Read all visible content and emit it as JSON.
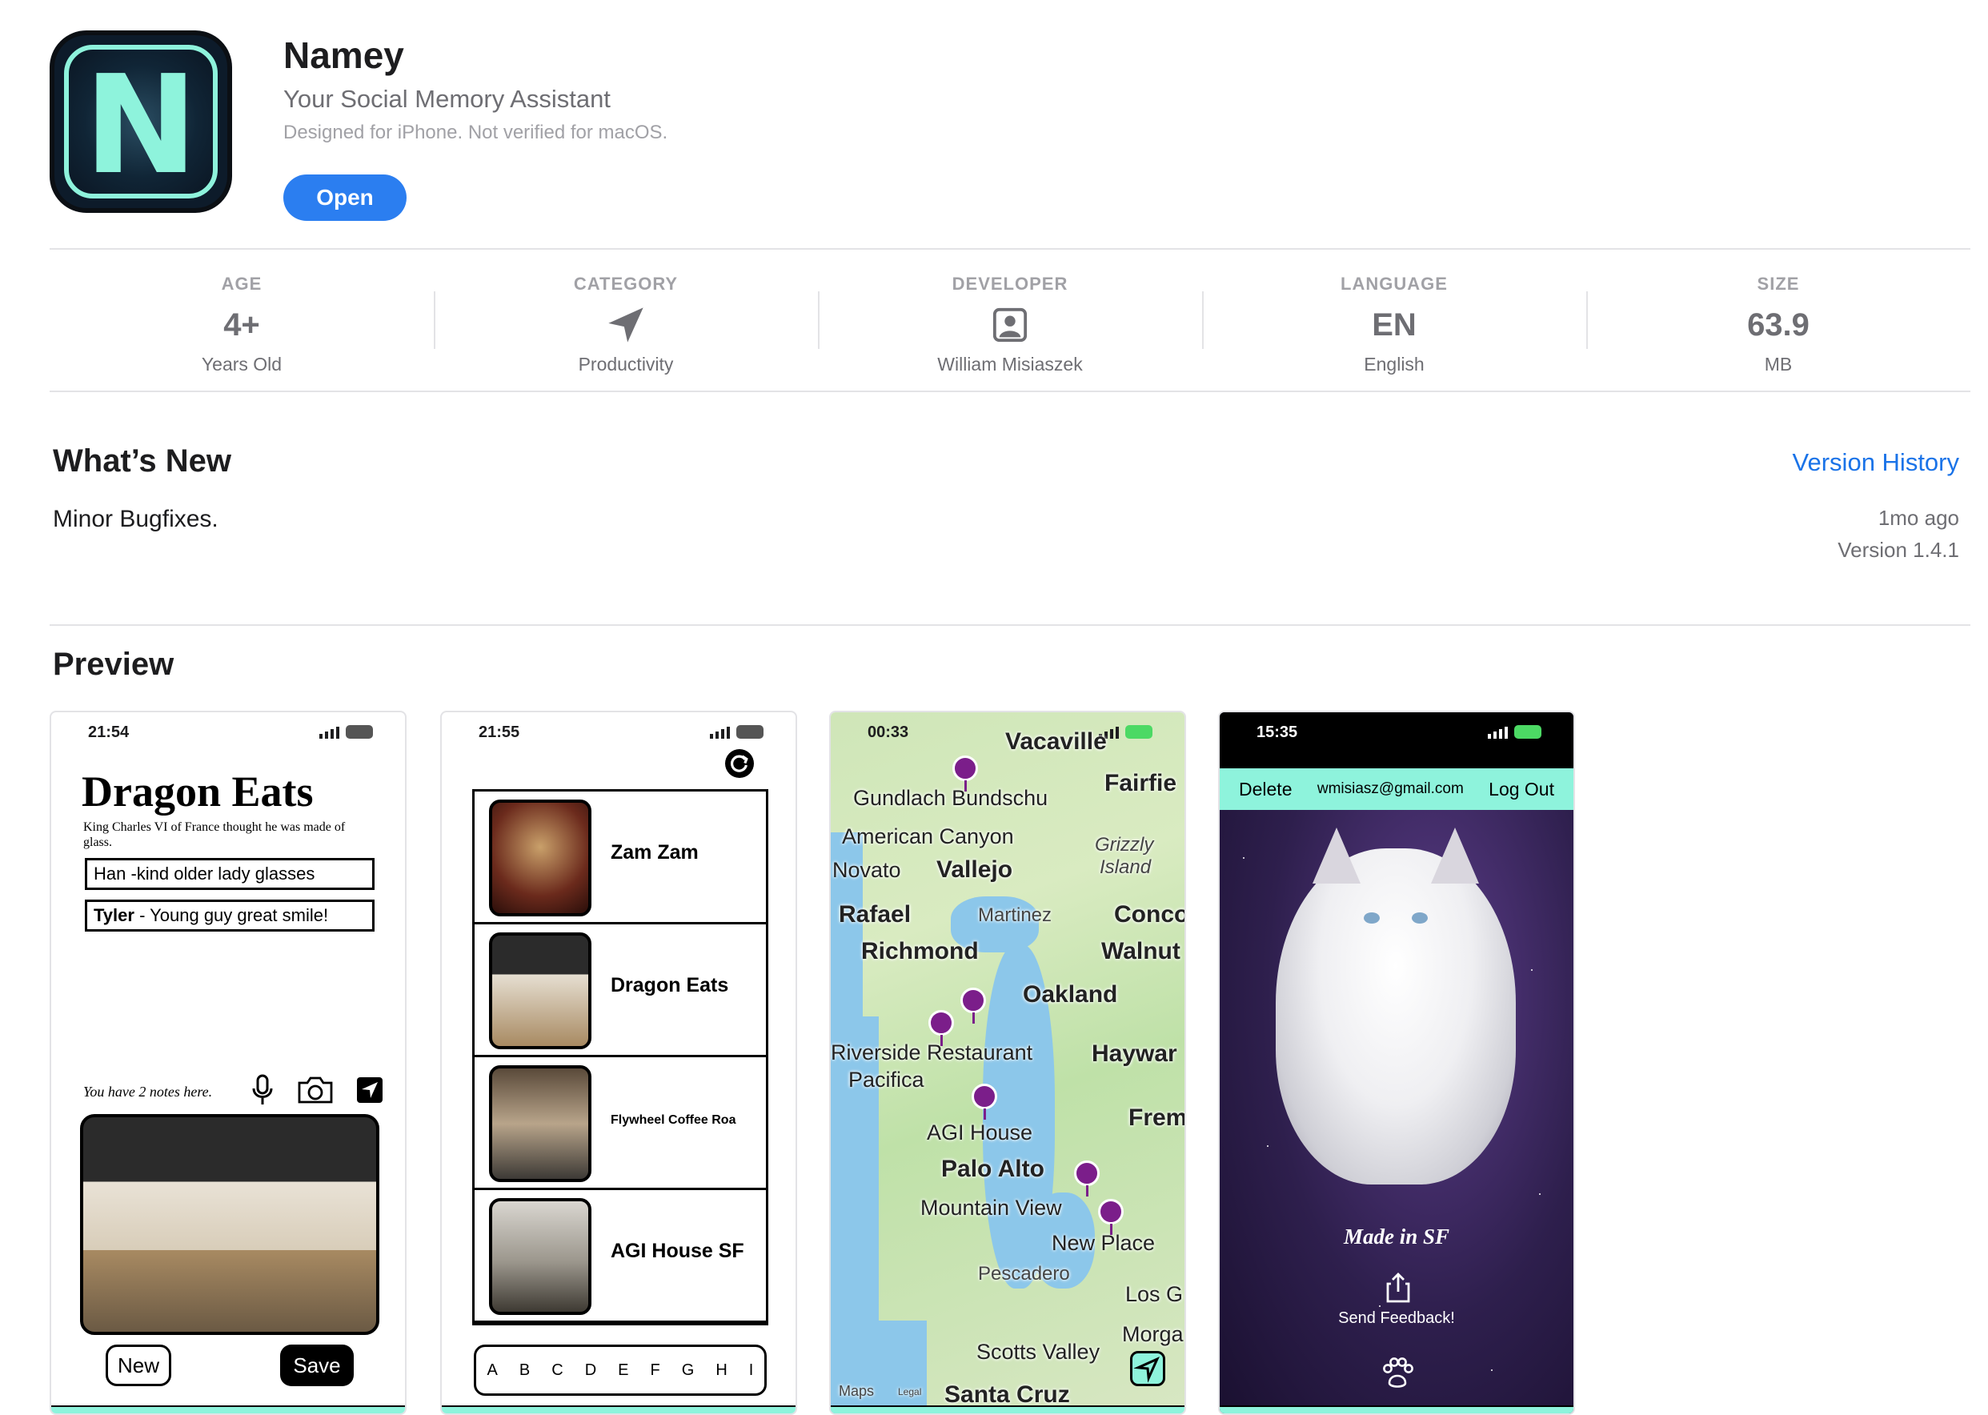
{
  "app": {
    "name": "Namey",
    "subtitle": "Your Social Memory Assistant",
    "note": "Designed for iPhone. Not verified for macOS.",
    "open_label": "Open",
    "icon_letter": "N",
    "icon_color": "#8ef3dc"
  },
  "info": [
    {
      "label": "AGE",
      "value": "4+",
      "sub": "Years Old"
    },
    {
      "label": "CATEGORY",
      "value": "",
      "icon": "paper-plane-icon",
      "sub": "Productivity"
    },
    {
      "label": "DEVELOPER",
      "value": "",
      "icon": "person-icon",
      "sub": "William Misiaszek"
    },
    {
      "label": "LANGUAGE",
      "value": "EN",
      "sub": "English"
    },
    {
      "label": "SIZE",
      "value": "63.9",
      "sub": "MB"
    }
  ],
  "whats_new": {
    "title": "What’s New",
    "version_history": "Version History",
    "body": "Minor Bugfixes.",
    "age": "1mo ago",
    "version": "Version 1.4.1"
  },
  "preview": {
    "title": "Preview",
    "shot1": {
      "time": "21:54",
      "title": "Dragon Eats",
      "quote": "King Charles VI of France thought he was made of glass.",
      "notes": [
        {
          "name": "Han",
          "text": " -kind older lady glasses"
        },
        {
          "name": "Tyler",
          "text": " - Young guy great smile!"
        }
      ],
      "count": "You have 2 notes here.",
      "new_label": "New",
      "save_label": "Save"
    },
    "shot2": {
      "time": "21:55",
      "places": [
        "Zam Zam",
        "Dragon Eats",
        "Flywheel Coffee Roa",
        "AGI House SF"
      ],
      "alphabet": [
        "A",
        "B",
        "C",
        "D",
        "E",
        "F",
        "G",
        "H",
        "I"
      ]
    },
    "shot3": {
      "time": "00:33",
      "labels": {
        "vacaville": "Vacaville",
        "fairfield": "Fairfie",
        "gundlach": "Gundlach Bundschu",
        "american_canyon": "American Canyon",
        "grizzly": "Grizzly",
        "island": "Island",
        "novato": "Novato",
        "vallejo": "Vallejo",
        "rafael": "Rafael",
        "martinez": "Martinez",
        "concord": "Conco",
        "richmond": "Richmond",
        "walnut": "Walnut",
        "oakland": "Oakland",
        "riverside": "Riverside Restaurant",
        "hayward": "Haywar",
        "pacifica": "Pacifica",
        "fremont": "Frem",
        "agi_house": "AGI House",
        "palo_alto": "Palo Alto",
        "mountain_view": "Mountain View",
        "new_place": "New Place",
        "pescadero": "Pescadero",
        "los_gatos": "Los G",
        "scotts_valley": "Scotts Valley",
        "morgan": "Morga",
        "santa_cruz": "Santa Cruz",
        "maps": "Maps",
        "legal": "Legal"
      }
    },
    "shot4": {
      "time": "15:35",
      "delete_label": "Delete",
      "email": "wmisiasz@gmail.com",
      "logout_label": "Log Out",
      "made_in": "Made in SF",
      "feedback": "Send Feedback!"
    }
  }
}
